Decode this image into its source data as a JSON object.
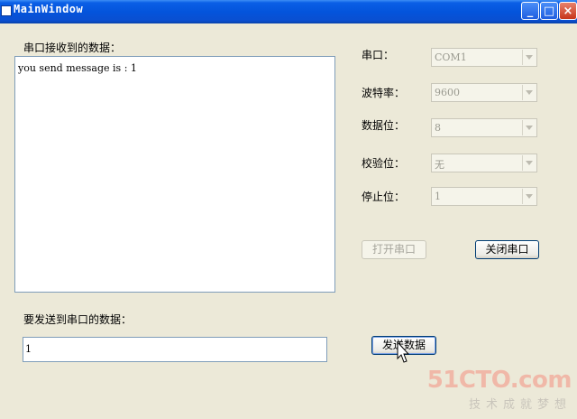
{
  "window": {
    "title": "MainWindow",
    "min_label": "_",
    "max_label": "□",
    "close_label": "×"
  },
  "receive": {
    "label": "串口接收到的数据：",
    "text": "you send message is : 1"
  },
  "settings": [
    {
      "label": "串口：",
      "value": "COM1"
    },
    {
      "label": "波特率：",
      "value": "9600"
    },
    {
      "label": "数据位：",
      "value": "8"
    },
    {
      "label": "校验位：",
      "value": "无"
    },
    {
      "label": "停止位：",
      "value": "1"
    }
  ],
  "buttons": {
    "open_port": "打开串口",
    "close_port": "关闭串口",
    "send": "发送数据"
  },
  "send": {
    "label": "要发送到串口的数据：",
    "value": "1"
  },
  "watermark": {
    "logo": "51CTO.com",
    "tagline": "技术成就梦想"
  }
}
